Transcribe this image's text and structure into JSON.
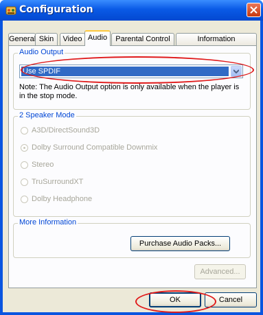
{
  "window": {
    "title": "Configuration"
  },
  "tabs": [
    {
      "label": "General"
    },
    {
      "label": "Skin"
    },
    {
      "label": "Video"
    },
    {
      "label": "Audio",
      "active": true
    },
    {
      "label": "Parental Control"
    },
    {
      "label": "Information"
    }
  ],
  "audio_output": {
    "group_label": "Audio Output",
    "selected": "Use SPDIF",
    "note": "Note:  The Audio Output option is only available when the player is in the stop mode."
  },
  "speaker_mode": {
    "group_label": "2 Speaker Mode",
    "options": [
      {
        "label": "A3D/DirectSound3D",
        "checked": false
      },
      {
        "label": "Dolby Surround Compatible Downmix",
        "checked": true
      },
      {
        "label": "Stereo",
        "checked": false
      },
      {
        "label": "TruSurroundXT",
        "checked": false
      },
      {
        "label": "Dolby Headphone",
        "checked": false
      }
    ],
    "enabled": false
  },
  "more_info": {
    "group_label": "More Information",
    "purchase_button": "Purchase Audio Packs..."
  },
  "advanced_button": "Advanced...",
  "footer": {
    "ok": "OK",
    "cancel": "Cancel"
  },
  "colors": {
    "titlebar": "#0a5ae6",
    "selection": "#316ac5",
    "group_label": "#0046d5",
    "highlight_callout": "#e01a1a",
    "active_tab_accent": "#ffc83c"
  }
}
